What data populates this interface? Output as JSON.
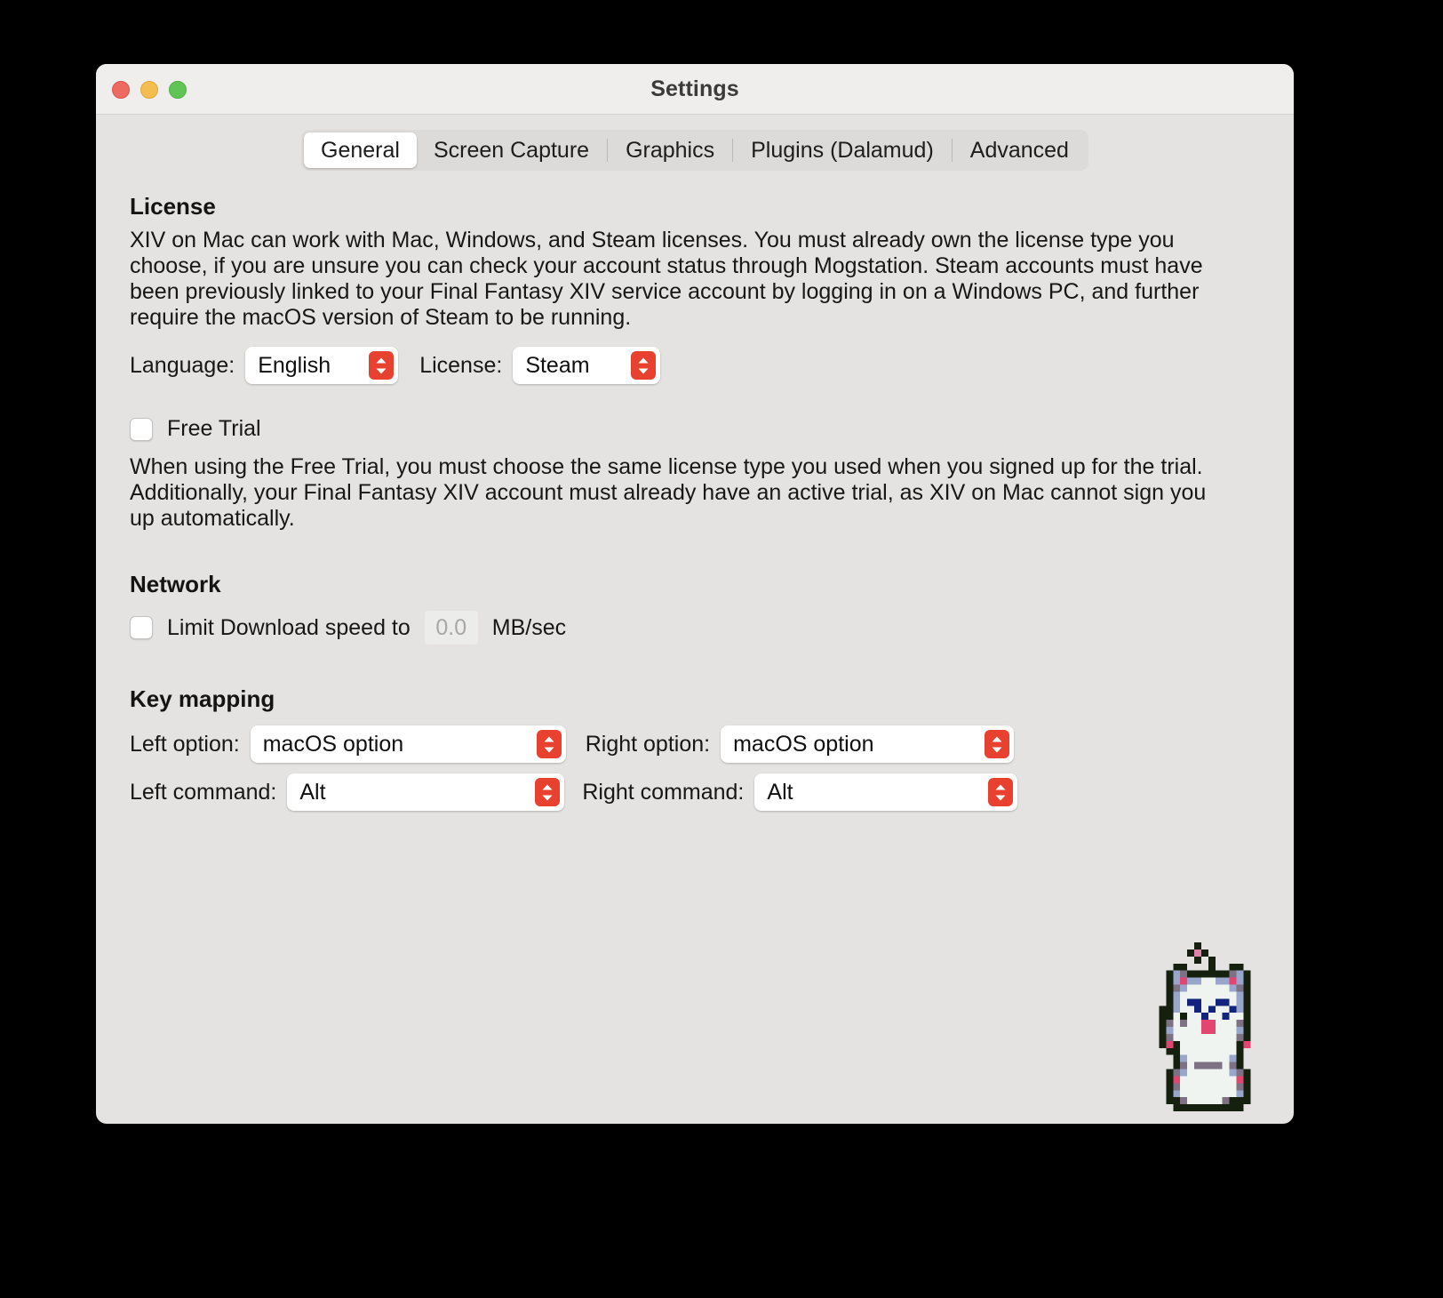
{
  "window": {
    "title": "Settings",
    "traffic_lights": [
      {
        "name": "close",
        "color": "#ec6a5f"
      },
      {
        "name": "minimize",
        "color": "#f4bd50"
      },
      {
        "name": "maximize",
        "color": "#61c555"
      }
    ]
  },
  "tabs": [
    {
      "label": "General",
      "active": true
    },
    {
      "label": "Screen Capture",
      "active": false
    },
    {
      "label": "Graphics",
      "active": false
    },
    {
      "label": "Plugins (Dalamud)",
      "active": false
    },
    {
      "label": "Advanced",
      "active": false
    }
  ],
  "license_section": {
    "heading": "License",
    "description": "XIV on Mac can work with Mac, Windows, and Steam licenses. You must already own the license type you choose, if you are unsure you can check your account status through Mogstation. Steam accounts must have been previously linked to your Final Fantasy XIV service account by logging in on a Windows PC, and further require the macOS version of Steam to be running.",
    "language_label": "Language:",
    "language_value": "English",
    "license_label": "License:",
    "license_value": "Steam"
  },
  "free_trial": {
    "label": "Free Trial",
    "checked": false,
    "description": "When using the Free Trial, you must choose the same license type you used when you signed up for the trial. Additionally, your Final Fantasy XIV account must already have an active trial, as XIV on Mac cannot sign you up automatically."
  },
  "network_section": {
    "heading": "Network",
    "limit_label": "Limit Download speed to",
    "limit_checked": false,
    "speed_value": "0.0",
    "unit_label": "MB/sec"
  },
  "key_mapping": {
    "heading": "Key mapping",
    "left_option_label": "Left option:",
    "left_option_value": "macOS option",
    "right_option_label": "Right option:",
    "right_option_value": "macOS option",
    "left_command_label": "Left command:",
    "left_command_value": "Alt",
    "right_command_label": "Right command:",
    "right_command_value": "Alt"
  },
  "mascot": {
    "name": "moogle-sprite"
  },
  "colors": {
    "accent": "#e8412f",
    "window_bg": "#e4e3e1",
    "titlebar_bg": "#efeeec",
    "text": "#171717"
  }
}
